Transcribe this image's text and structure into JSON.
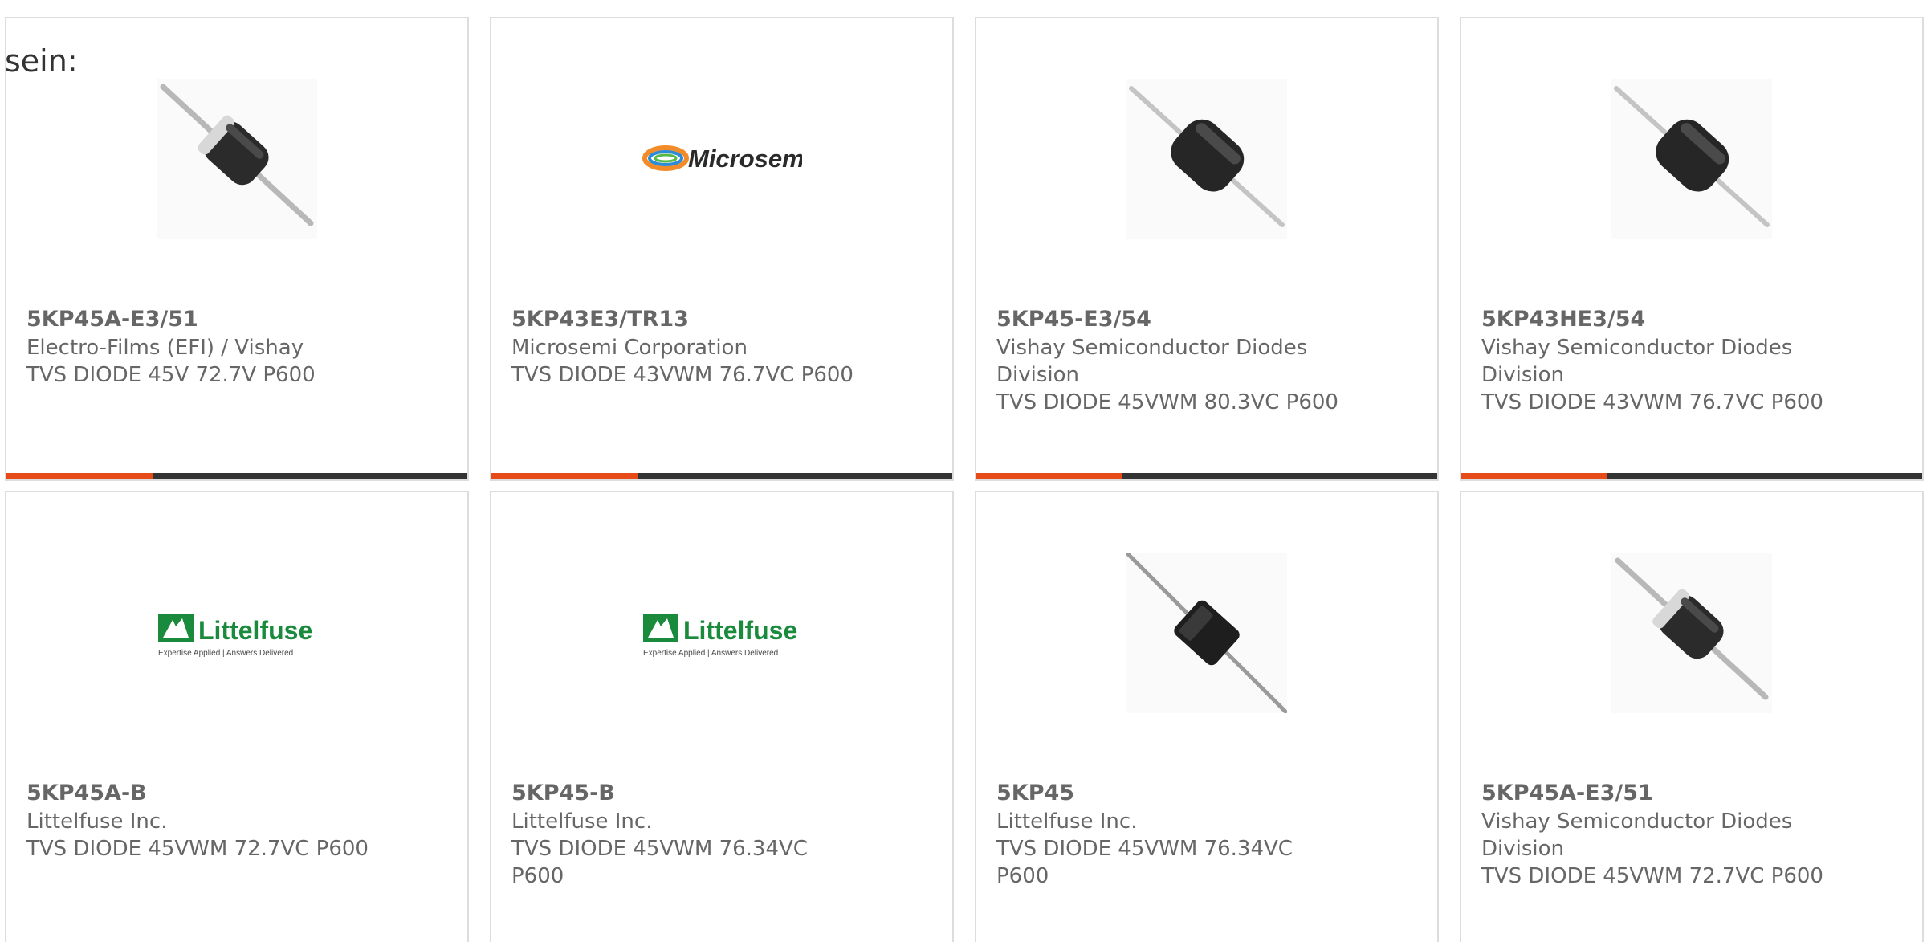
{
  "intro_text": "sein:",
  "colors": {
    "accent": "#e64a19",
    "bar_dark": "#333333",
    "text": "#666666",
    "littelfuse_green": "#1a8a3c"
  },
  "products": [
    {
      "part_number": "5KP45A-E3/51",
      "manufacturer": "Electro-Films (EFI) / Vishay",
      "description": "TVS DIODE 45V 72.7V P600",
      "image": "diode-gray-band-photo"
    },
    {
      "part_number": "5KP43E3/TR13",
      "manufacturer": "Microsemi Corporation",
      "description": "TVS DIODE 43VWM 76.7VC P600",
      "image": "microsemi-logo",
      "logo_text": "Microsemi"
    },
    {
      "part_number": "5KP45-E3/54",
      "manufacturer": "Vishay Semiconductor Diodes Division",
      "description": "TVS DIODE 45VWM 80.3VC P600",
      "image": "diode-black-photo"
    },
    {
      "part_number": "5KP43HE3/54",
      "manufacturer": "Vishay Semiconductor Diodes Division",
      "description": "TVS DIODE 43VWM 76.7VC P600",
      "image": "diode-black-photo"
    },
    {
      "part_number": "5KP45A-B",
      "manufacturer": "Littelfuse Inc.",
      "description": "TVS DIODE 45VWM 72.7VC P600",
      "image": "littelfuse-logo",
      "logo_text": "Littelfuse",
      "logo_tagline": "Expertise Applied | Answers Delivered"
    },
    {
      "part_number": "5KP45-B",
      "manufacturer": "Littelfuse Inc.",
      "description": "TVS DIODE 45VWM 76.34VC P600",
      "image": "littelfuse-logo",
      "logo_text": "Littelfuse",
      "logo_tagline": "Expertise Applied | Answers Delivered"
    },
    {
      "part_number": "5KP45",
      "manufacturer": "Littelfuse Inc.",
      "description": "TVS DIODE 45VWM 76.34VC P600",
      "image": "diode-black-square-photo"
    },
    {
      "part_number": "5KP45A-E3/51",
      "manufacturer": "Vishay Semiconductor Diodes Division",
      "description": "TVS DIODE 45VWM 72.7VC P600",
      "image": "diode-gray-band-photo"
    }
  ]
}
